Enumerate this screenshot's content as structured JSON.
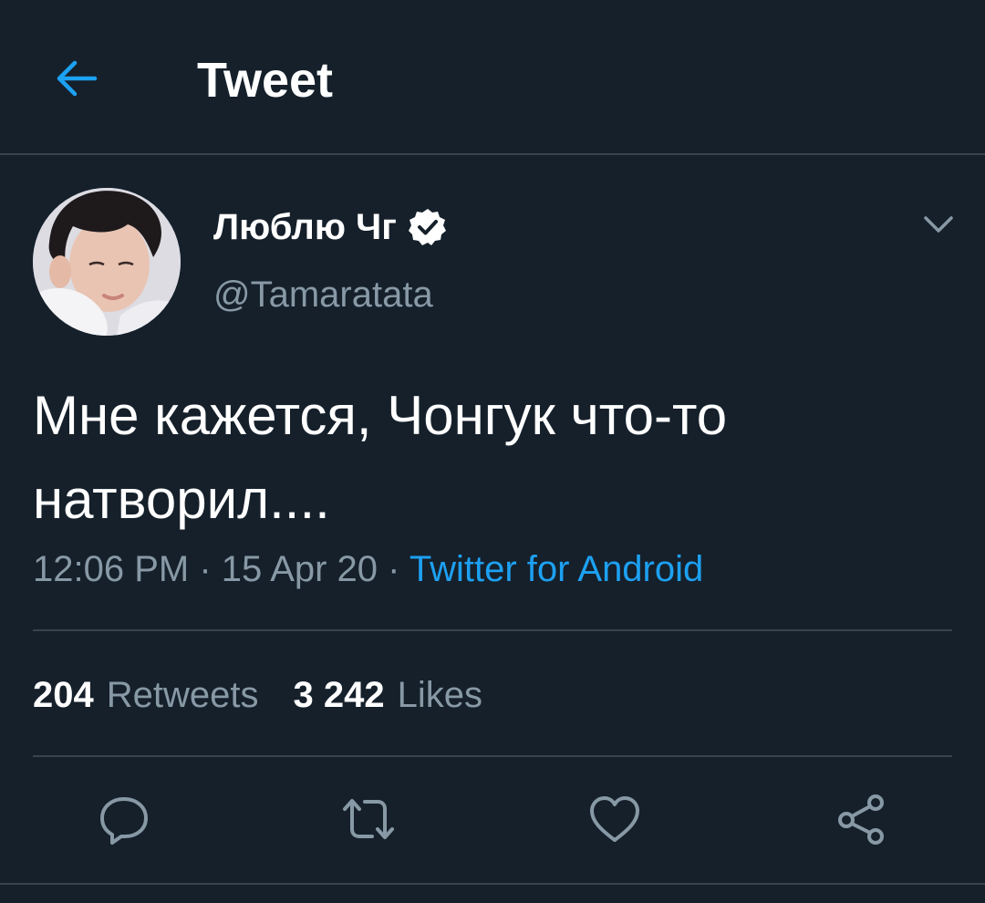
{
  "header": {
    "title": "Tweet",
    "back_icon": "arrow-left-icon"
  },
  "colors": {
    "background": "#15202b",
    "accent": "#1da1f2",
    "secondary_text": "#8899a6",
    "divider": "#38444d"
  },
  "author": {
    "display_name": "Люблю Чг",
    "handle": "@Tamaratata",
    "verified": true
  },
  "tweet": {
    "text": "Мне кажется, Чонгук что-то натворил....",
    "time": "12:06 PM",
    "separator": "·",
    "date": "15 Apr 20",
    "source": "Twitter for Android"
  },
  "stats": {
    "retweets_count": "204",
    "retweets_label": "Retweets",
    "likes_count": "3 242",
    "likes_label": "Likes"
  },
  "actions": [
    {
      "icon": "reply-icon"
    },
    {
      "icon": "retweet-icon"
    },
    {
      "icon": "like-icon"
    },
    {
      "icon": "share-icon"
    }
  ]
}
